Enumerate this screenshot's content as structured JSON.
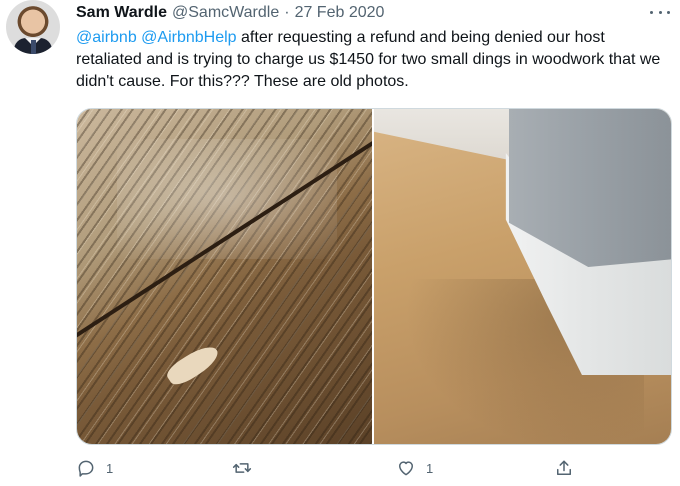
{
  "tweet": {
    "author_name": "Sam Wardle",
    "author_handle": "@SamcWardle",
    "separator": "·",
    "date": "27 Feb 2020",
    "mention_1": "@airbnb",
    "mention_2": "@AirbnbHelp",
    "text": " after requesting a refund and being denied our host retaliated and is trying to charge us $1450 for two small dings in woodwork that we didn't cause. For this???  These are old photos."
  },
  "media": {
    "photos": [
      {
        "icon": "photo-wood-floor-ding"
      },
      {
        "icon": "photo-skirting-board"
      }
    ]
  },
  "actions": {
    "reply_count": "1",
    "like_count": "1",
    "icons": [
      "reply-icon",
      "retweet-icon",
      "like-icon",
      "share-icon",
      "more-icon"
    ]
  },
  "colors": {
    "link": "#1d9bf0",
    "secondary_text": "#536471",
    "text": "#0f1419",
    "border": "#cfd9de"
  }
}
